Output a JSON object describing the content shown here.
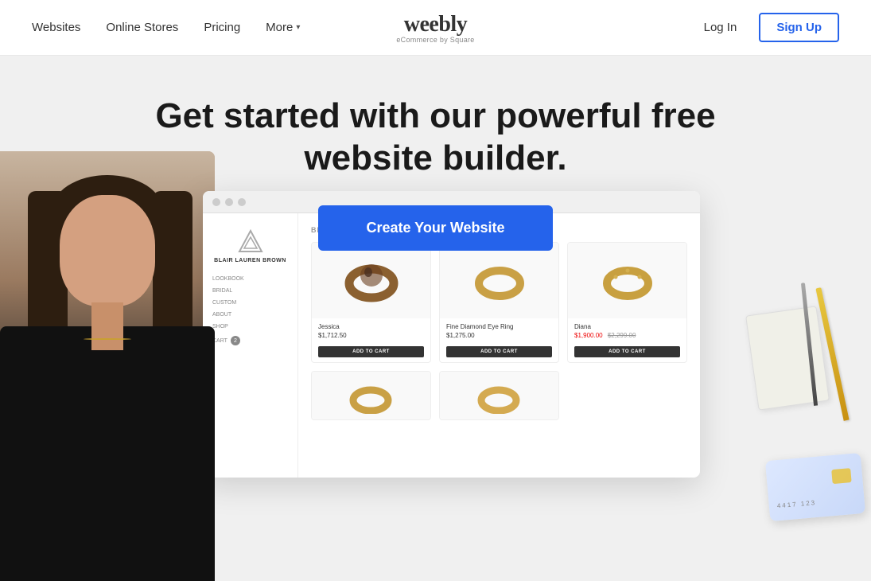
{
  "nav": {
    "links": [
      {
        "label": "Websites",
        "id": "websites"
      },
      {
        "label": "Online Stores",
        "id": "online-stores"
      },
      {
        "label": "Pricing",
        "id": "pricing"
      },
      {
        "label": "More",
        "id": "more"
      }
    ],
    "logo": {
      "brand": "weebly",
      "sub": "eCommerce by  Square"
    },
    "login_label": "Log In",
    "signup_label": "Sign Up"
  },
  "hero": {
    "headline_line1": "Get started with our powerful free",
    "headline_line2": "website builder.",
    "cta_label": "Create Your Website"
  },
  "store_mockup": {
    "brand_name": "BLAIR LAUREN BROWN",
    "nav_items": [
      "LOOKBOOK",
      "BRIDAL",
      "CUSTOM",
      "ABOUT",
      "SHOP"
    ],
    "cart_label": "CART",
    "cart_count": "2",
    "section_label": "BEST SELLERS",
    "products": [
      {
        "name": "Jessica",
        "price": "$1,712.50",
        "sale_price": null,
        "original_price": null,
        "btn_label": "ADD TO CART",
        "ring_type": "dark"
      },
      {
        "name": "Fine Diamond Eye Ring",
        "price": "$1,275.00",
        "sale_price": null,
        "original_price": null,
        "btn_label": "ADD TO CART",
        "ring_type": "plain"
      },
      {
        "name": "Diana",
        "price": null,
        "sale_price": "$1,900.00",
        "original_price": "$2,299.00",
        "btn_label": "ADD TO CART",
        "ring_type": "studded"
      }
    ]
  }
}
